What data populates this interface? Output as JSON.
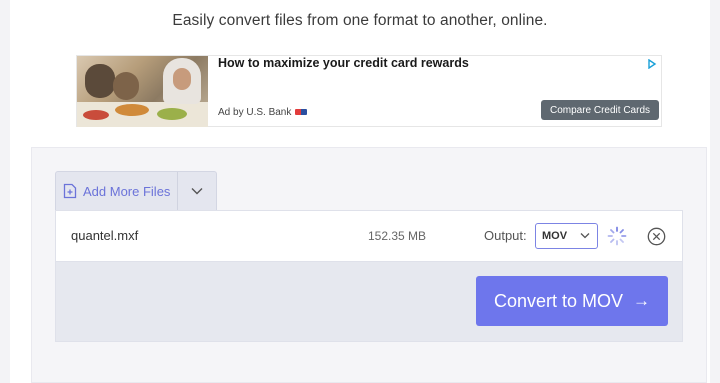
{
  "header": {
    "tagline": "Easily convert files from one format to another, online."
  },
  "ad": {
    "title": "How to maximize your credit card rewards",
    "advertiser": "Ad by U.S. Bank",
    "cta_label": "Compare Credit Cards"
  },
  "converter": {
    "add_files_label": "Add More Files",
    "file": {
      "name": "quantel.mxf",
      "size": "152.35 MB",
      "output_label": "Output:",
      "output_format": "MOV"
    },
    "convert_label": "Convert to MOV",
    "convert_arrow": "→"
  },
  "colors": {
    "accent": "#6e76ec",
    "accent_text": "#6b73d9"
  }
}
